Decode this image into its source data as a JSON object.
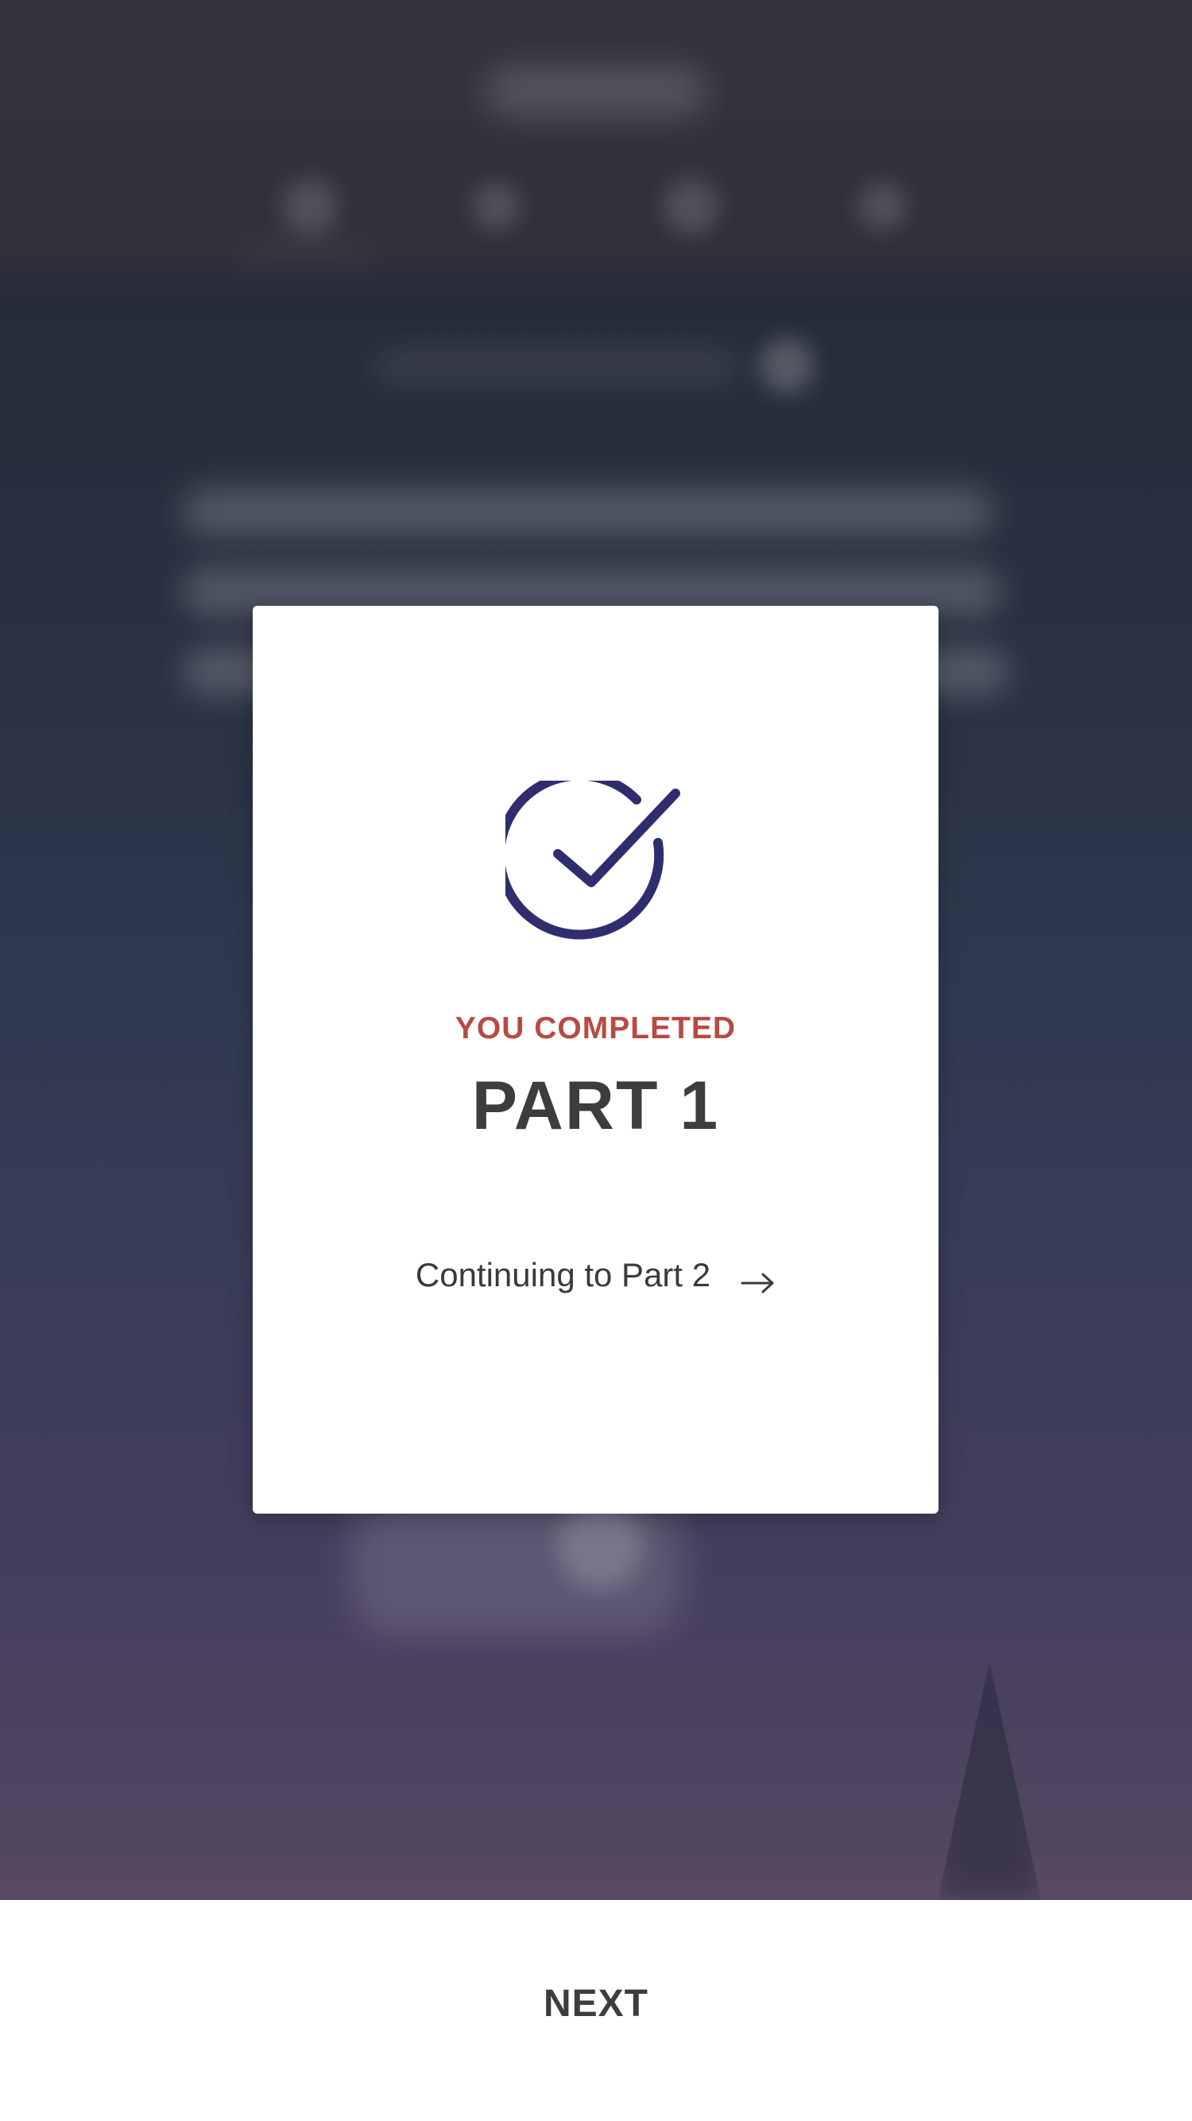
{
  "colors": {
    "accent": "#2e2e6e",
    "eyebrow": "#b84a42",
    "heading": "#3d3d3d",
    "surface": "#ffffff"
  },
  "modal": {
    "icon": "check-circle-icon",
    "eyebrow": "YOU COMPLETED",
    "title": "PART 1",
    "continue_text": "Continuing to Part 2",
    "continue_icon": "arrow-right-icon"
  },
  "footer": {
    "next_label": "NEXT"
  }
}
